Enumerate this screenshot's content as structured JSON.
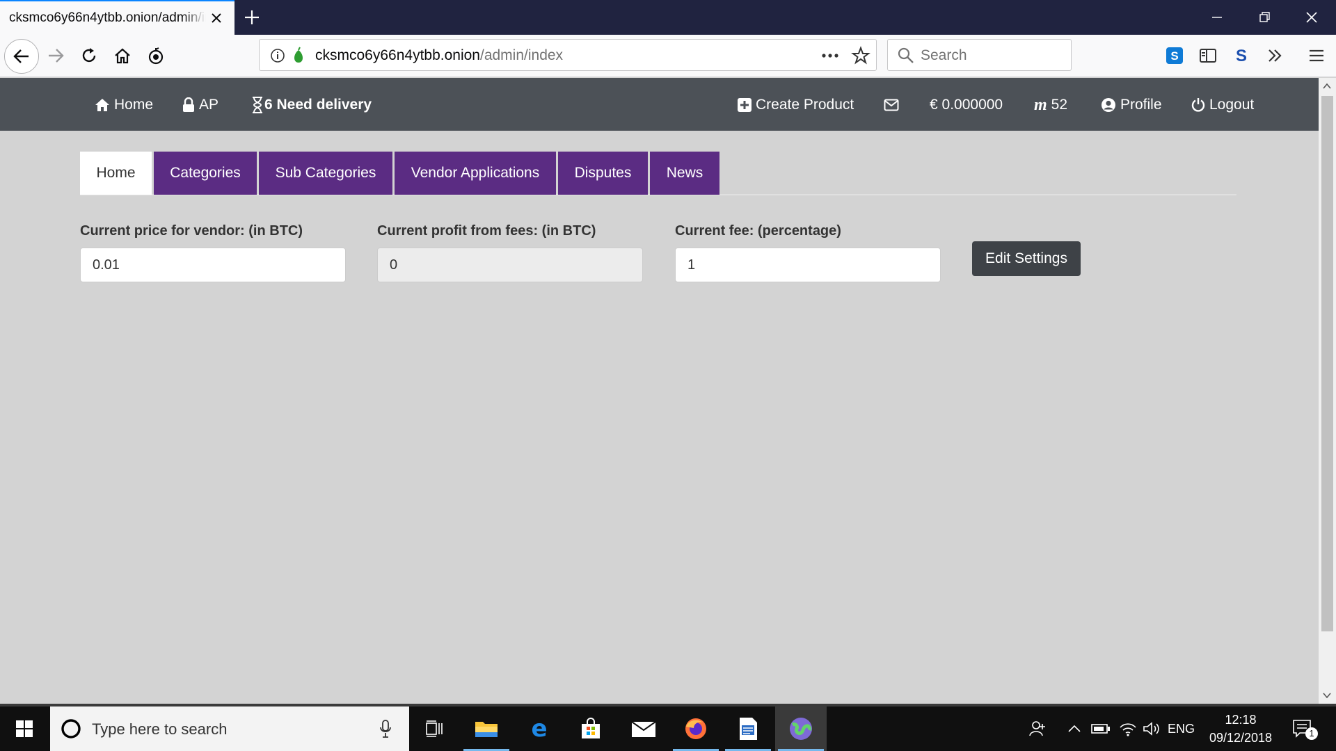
{
  "browser": {
    "tab_title": "cksmco6y66n4ytbb.onion/admin/index",
    "url_host": "cksmco6y66n4ytbb.onion",
    "url_path": "/admin/index",
    "search_placeholder": "Search"
  },
  "site_nav": {
    "home": "Home",
    "ap": "AP",
    "need_delivery": "6 Need delivery",
    "create_product": "Create Product",
    "balance": "€ 0.000000",
    "monero_count": "52",
    "profile": "Profile",
    "logout": "Logout"
  },
  "tabs": [
    {
      "label": "Home",
      "active": true
    },
    {
      "label": "Categories",
      "active": false
    },
    {
      "label": "Sub Categories",
      "active": false
    },
    {
      "label": "Vendor Applications",
      "active": false
    },
    {
      "label": "Disputes",
      "active": false
    },
    {
      "label": "News",
      "active": false
    }
  ],
  "settings": {
    "vendor_price_label": "Current price for vendor: (in BTC)",
    "vendor_price_value": "0.01",
    "profit_label": "Current profit from fees: (in BTC)",
    "profit_value": "0",
    "fee_label": "Current fee: (percentage)",
    "fee_value": "1",
    "edit_button": "Edit Settings"
  },
  "taskbar": {
    "search_placeholder": "Type here to search",
    "language": "ENG",
    "time": "12:18",
    "date": "09/12/2018",
    "notification_count": "1"
  },
  "colors": {
    "tab_purple": "#5b2c83",
    "site_nav_bg": "#4c5157",
    "page_bg": "#d3d3d3",
    "button_dark": "#3e4247"
  }
}
